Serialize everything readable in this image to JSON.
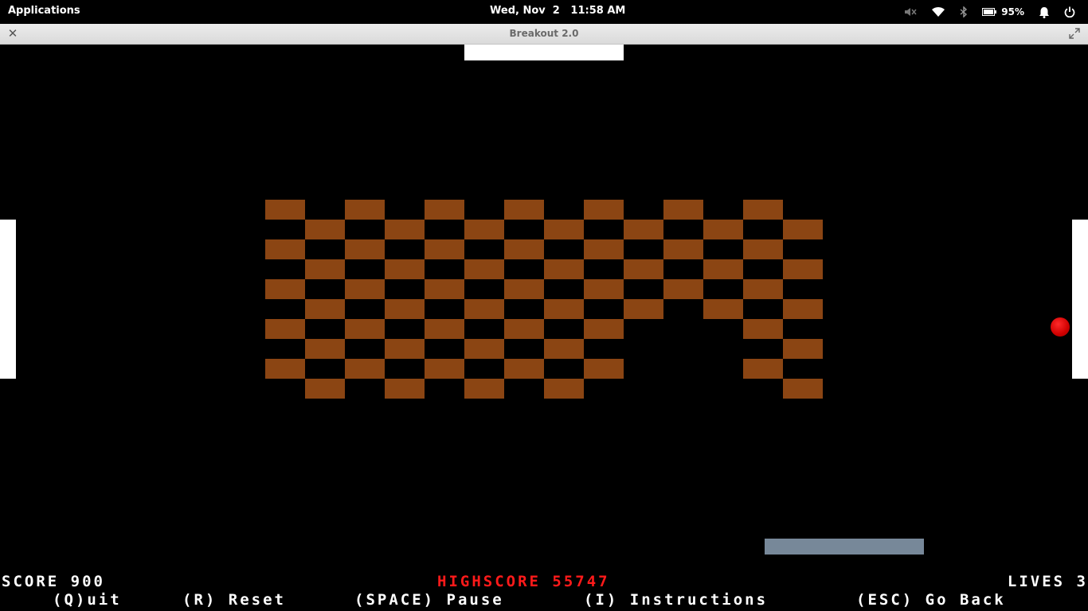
{
  "topbar": {
    "applications_label": "Applications",
    "clock": "Wed, Nov  2   11:58 AM",
    "battery_percent": "95%",
    "tray_icons": [
      "volume-muted-icon",
      "wifi-icon",
      "bluetooth-icon",
      "battery-icon",
      "bell-icon",
      "power-icon"
    ]
  },
  "window": {
    "title": "Breakout 2.0"
  },
  "colors": {
    "brick": "#8b4513",
    "paddle_white": "#ffffff",
    "paddle_player": "#778899",
    "ball": "#d00000",
    "highscore": "#ff1a1a"
  },
  "game": {
    "brick_columns": 14,
    "brick_rows": 10,
    "bricks_present": [
      [
        0,
        2,
        4,
        6,
        8,
        10,
        12
      ],
      [
        1,
        3,
        5,
        7,
        9,
        11,
        13
      ],
      [
        0,
        2,
        4,
        6,
        8,
        10,
        12
      ],
      [
        1,
        3,
        5,
        7,
        9,
        11,
        13
      ],
      [
        0,
        2,
        4,
        6,
        8,
        10,
        12
      ],
      [
        1,
        3,
        5,
        7,
        9,
        11,
        13
      ],
      [
        0,
        2,
        4,
        6,
        8,
        12
      ],
      [
        1,
        3,
        5,
        7,
        13
      ],
      [
        0,
        2,
        4,
        6,
        8,
        12
      ],
      [
        1,
        3,
        5,
        7,
        13
      ]
    ]
  },
  "hud": {
    "score": "SCORE 900",
    "highscore": "HIGHSCORE 55747",
    "lives": "LIVES 3",
    "controls": {
      "quit": "(Q)uit",
      "reset": "(R) Reset",
      "pause": "(SPACE) Pause",
      "instructions": "(I) Instructions",
      "back": "(ESC) Go Back"
    }
  }
}
